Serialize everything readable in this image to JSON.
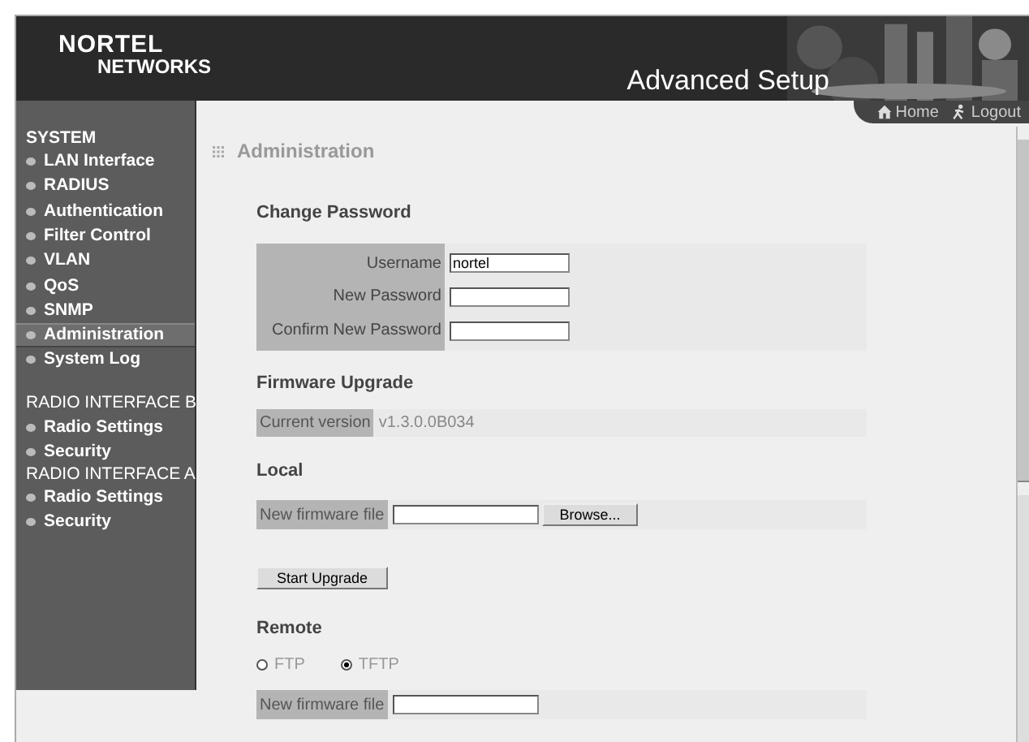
{
  "header": {
    "logo_top": "NORTEL",
    "logo_bottom": "NETWORKS",
    "title": "Advanced Setup",
    "links": [
      "Home",
      "Logout"
    ]
  },
  "sidebar": {
    "groups": [
      {
        "title": "SYSTEM",
        "items": [
          {
            "label": "LAN Interface",
            "selected": false
          },
          {
            "label": "RADIUS",
            "selected": false
          },
          {
            "label": "Authentication",
            "selected": false
          },
          {
            "label": "Filter Control",
            "selected": false
          },
          {
            "label": "VLAN",
            "selected": false
          },
          {
            "label": "QoS",
            "selected": false
          },
          {
            "label": "SNMP",
            "selected": false
          },
          {
            "label": "Administration",
            "selected": true
          },
          {
            "label": "System Log",
            "selected": false
          }
        ]
      },
      {
        "title": "RADIO INTERFACE B",
        "items": [
          {
            "label": "Radio Settings",
            "selected": false
          },
          {
            "label": "Security",
            "selected": false
          }
        ]
      },
      {
        "title": "RADIO INTERFACE A",
        "items": [
          {
            "label": "Radio Settings",
            "selected": false
          },
          {
            "label": "Security",
            "selected": false
          }
        ]
      }
    ]
  },
  "page_title": "Administration",
  "change_password": {
    "heading": "Change Password",
    "fields": [
      {
        "label": "Username",
        "value": "nortel"
      },
      {
        "label": "New Password"
      },
      {
        "label": "Confirm New Password"
      }
    ]
  },
  "firmware": {
    "heading": "Firmware Upgrade",
    "current_label": "Current version",
    "current_value": "v1.3.0.0B034",
    "local_heading": "Local",
    "local_file_label": "New firmware file",
    "browse_button": "Browse...",
    "start_button": "Start Upgrade",
    "remote_heading": "Remote",
    "protocols": [
      {
        "label": "FTP",
        "selected": false
      },
      {
        "label": "TFTP",
        "selected": true
      }
    ],
    "remote_file_label": "New firmware file"
  }
}
